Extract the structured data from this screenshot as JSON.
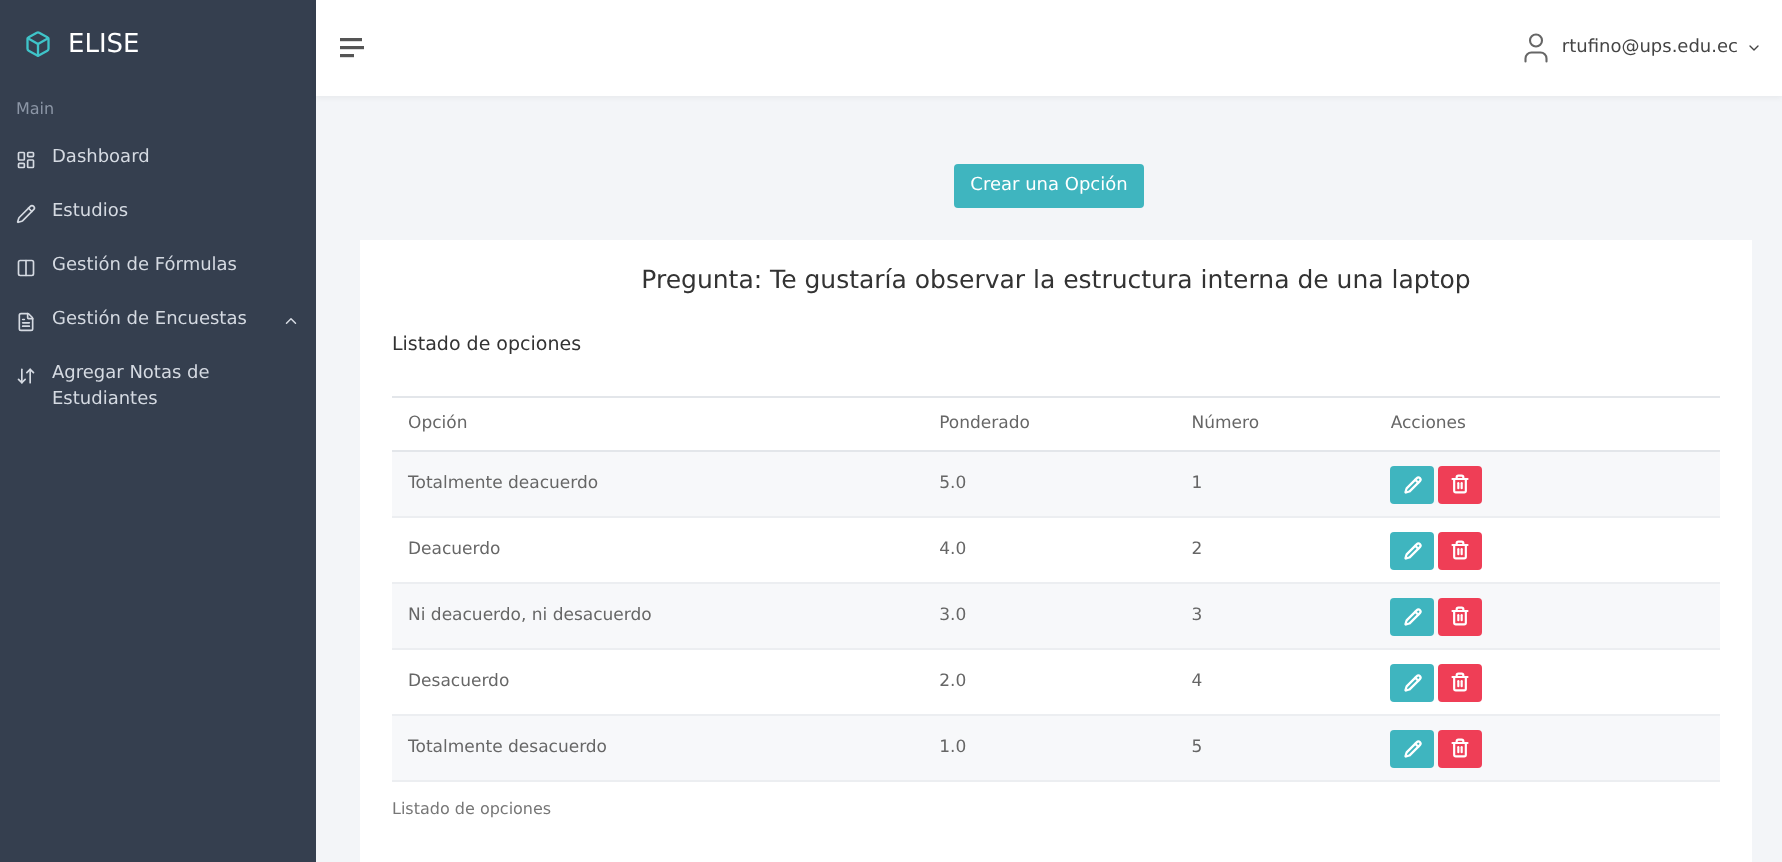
{
  "brand": "ELISE",
  "sidebar": {
    "section": "Main",
    "items": [
      {
        "label": "Dashboard"
      },
      {
        "label": "Estudios"
      },
      {
        "label": "Gestión de Fórmulas"
      },
      {
        "label": "Gestión de Encuestas",
        "expanded": true
      },
      {
        "label": "Agregar Notas de Estudiantes"
      }
    ]
  },
  "user": "rtufino@ups.edu.ec",
  "create_button": "Crear una Opción",
  "question": "Pregunta: Te gustaría observar la estructura interna de una laptop",
  "list_title": "Listado de opciones",
  "table": {
    "columns": [
      "Opción",
      "Ponderado",
      "Número",
      "Acciones"
    ],
    "rows": [
      {
        "option": "Totalmente deacuerdo",
        "weight": "5.0",
        "number": "1"
      },
      {
        "option": "Deacuerdo",
        "weight": "4.0",
        "number": "2"
      },
      {
        "option": "Ni deacuerdo, ni desacuerdo",
        "weight": "3.0",
        "number": "3"
      },
      {
        "option": "Desacuerdo",
        "weight": "2.0",
        "number": "4"
      },
      {
        "option": "Totalmente desacuerdo",
        "weight": "1.0",
        "number": "5"
      }
    ]
  },
  "caption": "Listado de opciones"
}
